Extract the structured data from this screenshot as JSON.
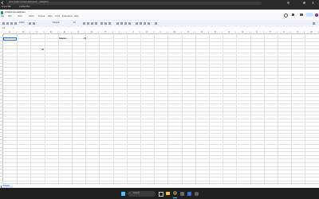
{
  "browser": {
    "url": "docs.google.com/spreadsheets/d/.../edit#gid=0",
    "bookmarks": [
      "Import Bar",
      "Untitled Bar"
    ]
  },
  "document": {
    "title": "Untitled spreadsheet"
  },
  "menu": {
    "items": [
      "File",
      "Edit",
      "View",
      "Insert",
      "Format",
      "Data",
      "Tools",
      "Extensions",
      "Help"
    ]
  },
  "toolbar": {
    "zoom": "100%",
    "font": "Default..",
    "font_size": "10"
  },
  "formula_bar": {
    "cell_ref": "A1",
    "value": ""
  },
  "grid": {
    "columns": [
      "A",
      "B",
      "C",
      "D",
      "E",
      "F",
      "G",
      "H",
      "I",
      "J",
      "K",
      "L",
      "M",
      "N",
      "O",
      "P",
      "Q",
      "R",
      "S",
      "T",
      "U",
      "V",
      "W"
    ],
    "cells": {
      "D3": "Salaries",
      "F3": "23",
      "C5": "29"
    }
  },
  "sheets": {
    "tabs": [
      "Sheet1"
    ]
  },
  "taskbar": {
    "search_placeholder": "Search"
  },
  "colors": {
    "accent": "#1a73e8",
    "header_bg": "#f8f9fa",
    "taskbar_bg": "#202020"
  }
}
